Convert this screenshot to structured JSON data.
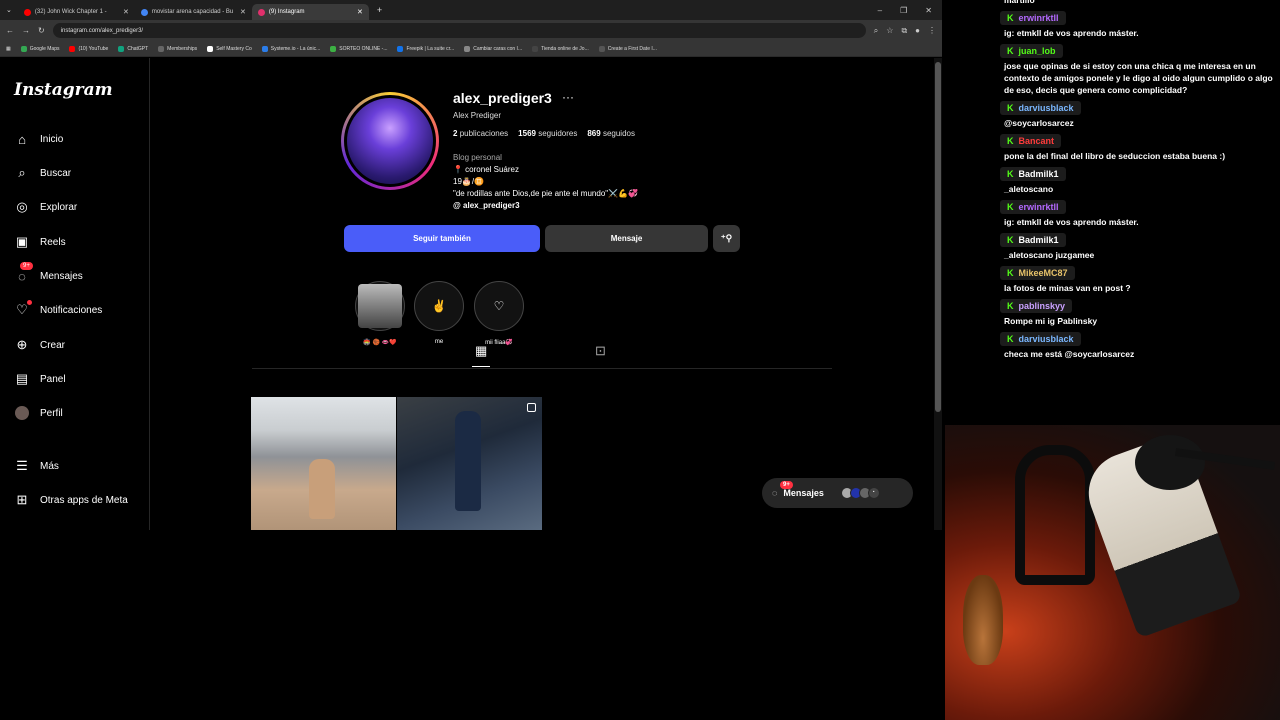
{
  "browser": {
    "tabs": [
      {
        "title": "(32) John Wick Chapter 1 -",
        "color": "#ff0000"
      },
      {
        "title": "movistar arena capacidad - Bu",
        "color": "#4285f4"
      },
      {
        "title": "(9) Instagram",
        "color": "#e1306c"
      }
    ],
    "url": "instagram.com/alex_prediger3/",
    "bookmarks": [
      "Google Maps",
      "(10) YouTube",
      "ChatGPT",
      "Memberships",
      "Self Mastery Co",
      "Systeme.io - La únic...",
      "SORTEO ONLINE -...",
      "Freepik | La suite cr...",
      "Cambiar caras con I...",
      "Tienda online de Jo...",
      "Create a First Date I..."
    ]
  },
  "instagram": {
    "logo": "Instagram",
    "nav": [
      {
        "label": "Inicio",
        "icon": "home-icon"
      },
      {
        "label": "Buscar",
        "icon": "search-icon"
      },
      {
        "label": "Explorar",
        "icon": "compass-icon"
      },
      {
        "label": "Reels",
        "icon": "reels-icon"
      },
      {
        "label": "Mensajes",
        "icon": "messenger-icon",
        "badge": "9+"
      },
      {
        "label": "Notificaciones",
        "icon": "heart-icon"
      },
      {
        "label": "Crear",
        "icon": "plus-icon"
      },
      {
        "label": "Panel",
        "icon": "chart-icon"
      },
      {
        "label": "Perfil",
        "icon": "avatar-icon"
      },
      {
        "label": "Más",
        "icon": "menu-icon"
      },
      {
        "label": "Otras apps de Meta",
        "icon": "meta-icon"
      }
    ],
    "profile": {
      "username": "alex_prediger3",
      "full_name": "Alex Prediger",
      "posts": "2",
      "posts_label": "publicaciones",
      "followers": "1569",
      "followers_label": "seguidores",
      "following": "869",
      "following_label": "seguidos",
      "category": "Blog personal",
      "bio_line1": "📍 coronel Suárez",
      "bio_line2": "19🎂/♊",
      "bio_line3": "\"de rodillas ante Dios,de pie ante el mundo\"⚔️💪💞",
      "threads": "alex_prediger3"
    },
    "buttons": {
      "follow": "Seguir también",
      "message": "Mensaje"
    },
    "highlights": [
      {
        "label": "🏟️ 🏀 👄❤️",
        "glyph": ""
      },
      {
        "label": "me",
        "glyph": "✌"
      },
      {
        "label": "mii fliaa💞",
        "glyph": "♡"
      }
    ],
    "chat_pill": {
      "label": "Mensajes",
      "badge": "9+"
    }
  },
  "chat": [
    {
      "user": "",
      "text": "martillo"
    },
    {
      "user": "erwinrktll",
      "text": "ig: etmkll de vos aprendo máster.",
      "color": "#b469ff"
    },
    {
      "user": "juan_lob",
      "text": "jose que opinas de si estoy con una chica q me interesa en un contexto de amigos ponele y le digo al oido algun cumplido o algo de eso, decis que genera como complicidad?",
      "color": "#53fc18"
    },
    {
      "user": "darviusblack",
      "text": "@soycarlosarcez",
      "color": "#7ab7ff"
    },
    {
      "user": "Bancant",
      "text": "pone la del final del libro de seduccion estaba buena :)",
      "color": "#ff3b3b"
    },
    {
      "user": "Badmilk1",
      "text": "_aletoscano",
      "color": "#ffffff"
    },
    {
      "user": "erwinrktll",
      "text": "ig: etmkll de vos aprendo máster.",
      "color": "#b469ff"
    },
    {
      "user": "Badmilk1",
      "text": "_aletoscano juzgamee",
      "color": "#ffffff"
    },
    {
      "user": "MikeeMC87",
      "text": "la fotos de minas van en post ?",
      "color": "#e8c36a"
    },
    {
      "user": "pablinskyy",
      "text": "Rompe mi ig Pablinsky",
      "color": "#c9a0ff"
    },
    {
      "user": "darviusblack",
      "text": "checa me está @soycarlosarcez",
      "color": "#7ab7ff"
    }
  ]
}
